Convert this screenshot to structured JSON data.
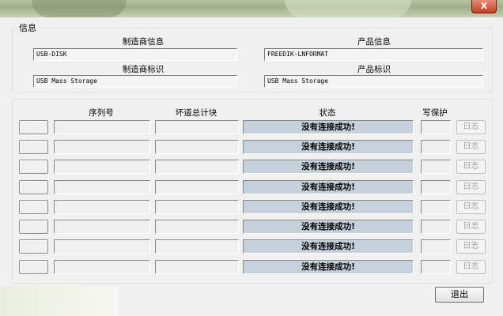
{
  "window": {
    "close_label": "X"
  },
  "info": {
    "group_title": "信息",
    "vendor_info_label": "制造商信息",
    "vendor_info_value": "USB-DISK",
    "product_info_label": "产品信息",
    "product_info_value": "FREEDIK-LNFORMAT",
    "vendor_id_label": "制造商标识",
    "vendor_id_value": "USB Mass Storage",
    "product_id_label": "产品标识",
    "product_id_value": "USB Mass Storage"
  },
  "table": {
    "columns": {
      "serial": "序列号",
      "bad_blocks": "坏道总计块",
      "status": "状态",
      "write_protect": "写保护"
    },
    "rows": [
      {
        "status": "没有连接成功!",
        "log": "日志"
      },
      {
        "status": "没有连接成功!",
        "log": "日志"
      },
      {
        "status": "没有连接成功!",
        "log": "日志"
      },
      {
        "status": "没有连接成功!",
        "log": "日志"
      },
      {
        "status": "没有连接成功!",
        "log": "日志"
      },
      {
        "status": "没有连接成功!",
        "log": "日志"
      },
      {
        "status": "没有连接成功!",
        "log": "日志"
      },
      {
        "status": "没有连接成功!",
        "log": "日志"
      }
    ]
  },
  "exit_label": "退出",
  "colors": {
    "status_bg": "#c6d0db",
    "close_red": "#c53d23"
  }
}
